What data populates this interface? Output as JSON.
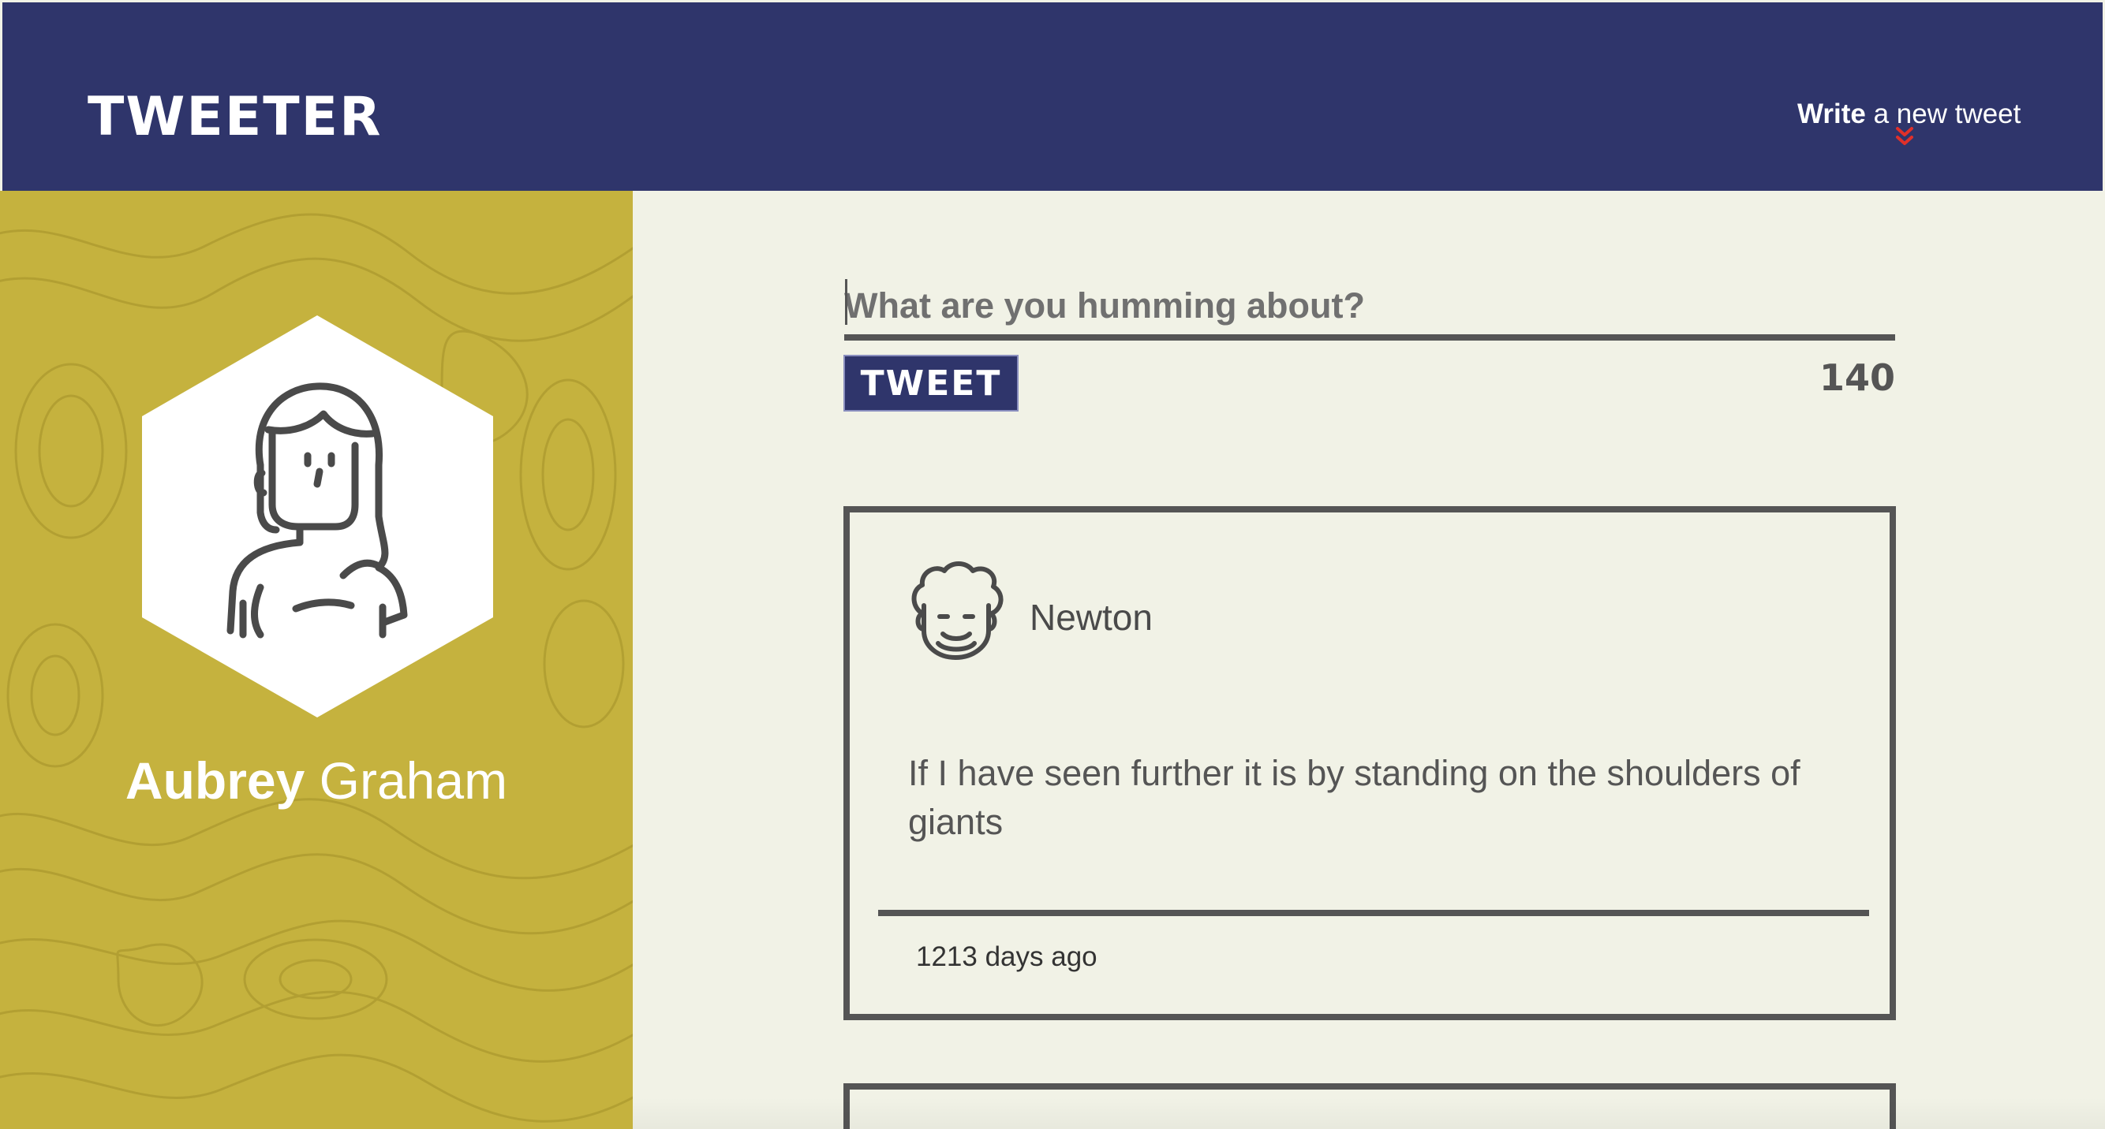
{
  "nav": {
    "brand": "TWEETER",
    "compose_bold": "Write",
    "compose_rest": " a new tweet",
    "compose_icon": "double-chevron-down-icon"
  },
  "profile": {
    "first_name": "Aubrey",
    "last_name": " Graham",
    "avatar_icon": "woman-avatar-icon"
  },
  "composer": {
    "placeholder": "What are you humming about?",
    "button_label": "TWEET",
    "counter": "140"
  },
  "tweets": [
    {
      "author": "Newton",
      "avatar_icon": "curly-hair-man-avatar-icon",
      "text": "If I have seen further it is by standing on the shoulders of giants",
      "time": "1213 days ago"
    }
  ],
  "colors": {
    "nav_bg": "#2f356b",
    "sidebar_bg": "#c5b23e",
    "page_bg": "#f1f2e6",
    "accent_red": "#e0302a",
    "text_gray": "#555555"
  }
}
